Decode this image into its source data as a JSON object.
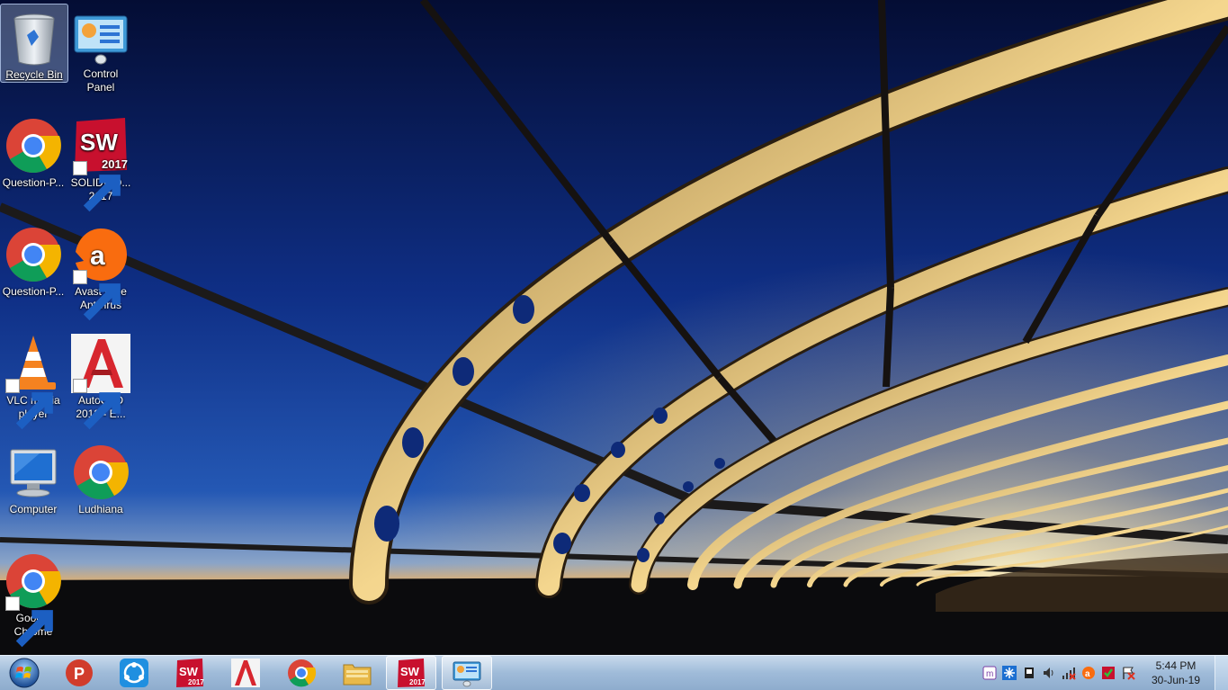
{
  "desktop": {
    "icons": [
      {
        "label": "Recycle Bin",
        "icon": "recycle-bin-icon",
        "selected": true
      },
      {
        "label": "Control Panel",
        "icon": "control-panel-icon"
      },
      {
        "label": "Question-P...",
        "icon": "chrome-icon"
      },
      {
        "label": "SOLIDWO... 2017",
        "icon": "solidworks-icon",
        "badge": "2017"
      },
      {
        "label": "Question-P...",
        "icon": "chrome-icon"
      },
      {
        "label": "Avast Free Antivirus",
        "icon": "avast-icon"
      },
      {
        "label": "VLC media player",
        "icon": "vlc-icon"
      },
      {
        "label": "AutoCAD 2018 - E...",
        "icon": "autocad-icon"
      },
      {
        "label": "Computer",
        "icon": "computer-icon"
      },
      {
        "label": "Ludhiana",
        "icon": "chrome-icon"
      },
      {
        "label": "Google Chrome",
        "icon": "chrome-icon"
      }
    ]
  },
  "taskbar": {
    "start_icon": "windows-start-orb-icon",
    "pinned": [
      {
        "name": "pdf-reader-icon"
      },
      {
        "name": "teamviewer-icon"
      },
      {
        "name": "solidworks-icon",
        "badge": "2017"
      },
      {
        "name": "autocad-icon"
      },
      {
        "name": "chrome-icon"
      },
      {
        "name": "file-explorer-icon"
      },
      {
        "name": "solidworks-icon",
        "badge": "2017"
      },
      {
        "name": "control-panel-icon"
      }
    ],
    "tray_icons": [
      "app-tray-icon",
      "network-sync-icon",
      "device-icon",
      "volume-icon",
      "network-icon",
      "avast-tray-icon",
      "solidworks-tray-icon",
      "action-center-flag-icon"
    ],
    "clock": {
      "time": "5:44 PM",
      "date": "30-Jun-19"
    }
  },
  "colors": {
    "sky_top": "#061244",
    "sky_mid": "#1b47a8",
    "horizon": "#d9a85a",
    "taskbar": "#a8c3df"
  }
}
